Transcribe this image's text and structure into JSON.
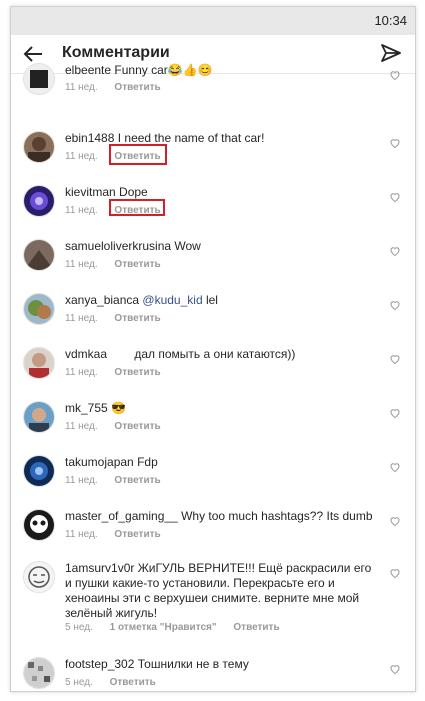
{
  "status": {
    "time": "10:34"
  },
  "header": {
    "title": "Комментарии"
  },
  "labels": {
    "reply": "Ответить"
  },
  "comments": [
    {
      "user": "elbeente",
      "text": "Funny car😂👍😊",
      "age": "11 нед.",
      "likes": ""
    },
    {
      "user": "ebin1488",
      "text": "I need the name of that car!",
      "age": "11 нед.",
      "likes": ""
    },
    {
      "user": "kievitman",
      "text": "Dope",
      "age": "11 нед.",
      "likes": ""
    },
    {
      "user": "samueloliverkrusina",
      "text": "Wow",
      "age": "11 нед.",
      "likes": ""
    },
    {
      "user": "xanya_bianca",
      "mention": "@kudu_kid",
      "text": "lel",
      "age": "11 нед.",
      "likes": ""
    },
    {
      "user": "vdmkaa",
      "text": "дал помыть а они катаются))",
      "age": "11 нед.",
      "likes": ""
    },
    {
      "user": "mk_755",
      "text": "😎",
      "age": "11 нед.",
      "likes": ""
    },
    {
      "user": "takumojapan",
      "text": "Fdp",
      "age": "11 нед.",
      "likes": ""
    },
    {
      "user": "master_of_gaming__",
      "text": "Why too much hashtags?? Its dumb",
      "age": "11 нед.",
      "likes": ""
    },
    {
      "user": "1amsurv1v0r",
      "text": "ЖиГУЛЬ ВЕРНИТЕ!!! Ещё раскрасили его  и пушки какие-то установили. Перекрасьте его и хеноаины эти с верхушеи снимите. верните мне мой зелёный жигуль!",
      "age": "5 нед.",
      "likes": "1 отметка \"Нравится\""
    },
    {
      "user": "footstep_302",
      "text": "Тошнилки не в тему",
      "age": "5 нед.",
      "likes": ""
    }
  ]
}
